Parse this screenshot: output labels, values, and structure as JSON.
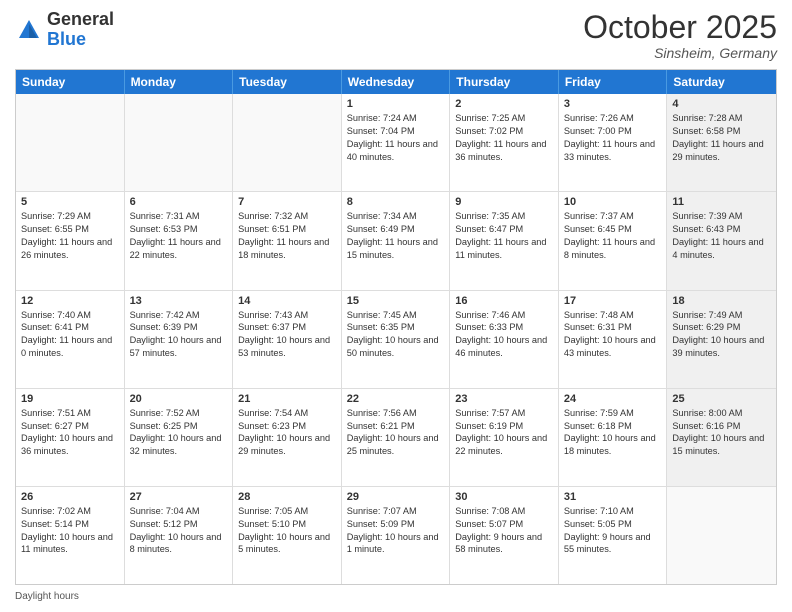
{
  "header": {
    "logo": {
      "general": "General",
      "blue": "Blue"
    },
    "title": "October 2025",
    "location": "Sinsheim, Germany"
  },
  "days_of_week": [
    "Sunday",
    "Monday",
    "Tuesday",
    "Wednesday",
    "Thursday",
    "Friday",
    "Saturday"
  ],
  "footer": "Daylight hours",
  "weeks": [
    [
      {
        "day": "",
        "sunrise": "",
        "sunset": "",
        "daylight": "",
        "empty": true
      },
      {
        "day": "",
        "sunrise": "",
        "sunset": "",
        "daylight": "",
        "empty": true
      },
      {
        "day": "",
        "sunrise": "",
        "sunset": "",
        "daylight": "",
        "empty": true
      },
      {
        "day": "1",
        "sunrise": "Sunrise: 7:24 AM",
        "sunset": "Sunset: 7:04 PM",
        "daylight": "Daylight: 11 hours and 40 minutes."
      },
      {
        "day": "2",
        "sunrise": "Sunrise: 7:25 AM",
        "sunset": "Sunset: 7:02 PM",
        "daylight": "Daylight: 11 hours and 36 minutes."
      },
      {
        "day": "3",
        "sunrise": "Sunrise: 7:26 AM",
        "sunset": "Sunset: 7:00 PM",
        "daylight": "Daylight: 11 hours and 33 minutes."
      },
      {
        "day": "4",
        "sunrise": "Sunrise: 7:28 AM",
        "sunset": "Sunset: 6:58 PM",
        "daylight": "Daylight: 11 hours and 29 minutes.",
        "shaded": true
      }
    ],
    [
      {
        "day": "5",
        "sunrise": "Sunrise: 7:29 AM",
        "sunset": "Sunset: 6:55 PM",
        "daylight": "Daylight: 11 hours and 26 minutes."
      },
      {
        "day": "6",
        "sunrise": "Sunrise: 7:31 AM",
        "sunset": "Sunset: 6:53 PM",
        "daylight": "Daylight: 11 hours and 22 minutes."
      },
      {
        "day": "7",
        "sunrise": "Sunrise: 7:32 AM",
        "sunset": "Sunset: 6:51 PM",
        "daylight": "Daylight: 11 hours and 18 minutes."
      },
      {
        "day": "8",
        "sunrise": "Sunrise: 7:34 AM",
        "sunset": "Sunset: 6:49 PM",
        "daylight": "Daylight: 11 hours and 15 minutes."
      },
      {
        "day": "9",
        "sunrise": "Sunrise: 7:35 AM",
        "sunset": "Sunset: 6:47 PM",
        "daylight": "Daylight: 11 hours and 11 minutes."
      },
      {
        "day": "10",
        "sunrise": "Sunrise: 7:37 AM",
        "sunset": "Sunset: 6:45 PM",
        "daylight": "Daylight: 11 hours and 8 minutes."
      },
      {
        "day": "11",
        "sunrise": "Sunrise: 7:39 AM",
        "sunset": "Sunset: 6:43 PM",
        "daylight": "Daylight: 11 hours and 4 minutes.",
        "shaded": true
      }
    ],
    [
      {
        "day": "12",
        "sunrise": "Sunrise: 7:40 AM",
        "sunset": "Sunset: 6:41 PM",
        "daylight": "Daylight: 11 hours and 0 minutes."
      },
      {
        "day": "13",
        "sunrise": "Sunrise: 7:42 AM",
        "sunset": "Sunset: 6:39 PM",
        "daylight": "Daylight: 10 hours and 57 minutes."
      },
      {
        "day": "14",
        "sunrise": "Sunrise: 7:43 AM",
        "sunset": "Sunset: 6:37 PM",
        "daylight": "Daylight: 10 hours and 53 minutes."
      },
      {
        "day": "15",
        "sunrise": "Sunrise: 7:45 AM",
        "sunset": "Sunset: 6:35 PM",
        "daylight": "Daylight: 10 hours and 50 minutes."
      },
      {
        "day": "16",
        "sunrise": "Sunrise: 7:46 AM",
        "sunset": "Sunset: 6:33 PM",
        "daylight": "Daylight: 10 hours and 46 minutes."
      },
      {
        "day": "17",
        "sunrise": "Sunrise: 7:48 AM",
        "sunset": "Sunset: 6:31 PM",
        "daylight": "Daylight: 10 hours and 43 minutes."
      },
      {
        "day": "18",
        "sunrise": "Sunrise: 7:49 AM",
        "sunset": "Sunset: 6:29 PM",
        "daylight": "Daylight: 10 hours and 39 minutes.",
        "shaded": true
      }
    ],
    [
      {
        "day": "19",
        "sunrise": "Sunrise: 7:51 AM",
        "sunset": "Sunset: 6:27 PM",
        "daylight": "Daylight: 10 hours and 36 minutes."
      },
      {
        "day": "20",
        "sunrise": "Sunrise: 7:52 AM",
        "sunset": "Sunset: 6:25 PM",
        "daylight": "Daylight: 10 hours and 32 minutes."
      },
      {
        "day": "21",
        "sunrise": "Sunrise: 7:54 AM",
        "sunset": "Sunset: 6:23 PM",
        "daylight": "Daylight: 10 hours and 29 minutes."
      },
      {
        "day": "22",
        "sunrise": "Sunrise: 7:56 AM",
        "sunset": "Sunset: 6:21 PM",
        "daylight": "Daylight: 10 hours and 25 minutes."
      },
      {
        "day": "23",
        "sunrise": "Sunrise: 7:57 AM",
        "sunset": "Sunset: 6:19 PM",
        "daylight": "Daylight: 10 hours and 22 minutes."
      },
      {
        "day": "24",
        "sunrise": "Sunrise: 7:59 AM",
        "sunset": "Sunset: 6:18 PM",
        "daylight": "Daylight: 10 hours and 18 minutes."
      },
      {
        "day": "25",
        "sunrise": "Sunrise: 8:00 AM",
        "sunset": "Sunset: 6:16 PM",
        "daylight": "Daylight: 10 hours and 15 minutes.",
        "shaded": true
      }
    ],
    [
      {
        "day": "26",
        "sunrise": "Sunrise: 7:02 AM",
        "sunset": "Sunset: 5:14 PM",
        "daylight": "Daylight: 10 hours and 11 minutes."
      },
      {
        "day": "27",
        "sunrise": "Sunrise: 7:04 AM",
        "sunset": "Sunset: 5:12 PM",
        "daylight": "Daylight: 10 hours and 8 minutes."
      },
      {
        "day": "28",
        "sunrise": "Sunrise: 7:05 AM",
        "sunset": "Sunset: 5:10 PM",
        "daylight": "Daylight: 10 hours and 5 minutes."
      },
      {
        "day": "29",
        "sunrise": "Sunrise: 7:07 AM",
        "sunset": "Sunset: 5:09 PM",
        "daylight": "Daylight: 10 hours and 1 minute."
      },
      {
        "day": "30",
        "sunrise": "Sunrise: 7:08 AM",
        "sunset": "Sunset: 5:07 PM",
        "daylight": "Daylight: 9 hours and 58 minutes."
      },
      {
        "day": "31",
        "sunrise": "Sunrise: 7:10 AM",
        "sunset": "Sunset: 5:05 PM",
        "daylight": "Daylight: 9 hours and 55 minutes."
      },
      {
        "day": "",
        "sunrise": "",
        "sunset": "",
        "daylight": "",
        "empty": true,
        "shaded": true
      }
    ]
  ]
}
